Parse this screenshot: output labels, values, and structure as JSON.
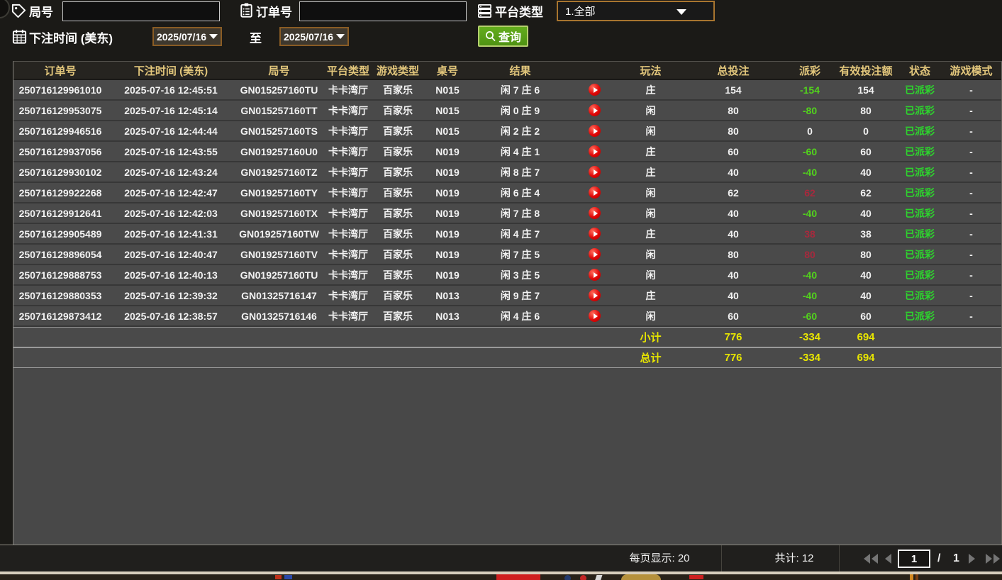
{
  "filters": {
    "round": {
      "label": "局号",
      "value": ""
    },
    "order": {
      "label": "订单号",
      "value": ""
    },
    "platform": {
      "label": "平台类型",
      "value": "1.全部"
    },
    "bet_time": {
      "label": "下注时间 (美东)"
    },
    "date_from": "2025/07/16",
    "to_label": "至",
    "date_to": "2025/07/16",
    "query_label": "查询"
  },
  "table": {
    "headers": [
      "订单号",
      "下注时间 (美东)",
      "局号",
      "平台类型",
      "游戏类型",
      "桌号",
      "结果",
      "",
      "玩法",
      "总投注",
      "派彩",
      "有效投注额",
      "状态",
      "游戏模式"
    ],
    "rows": [
      {
        "order_no": "250716129961010",
        "bet_time": "2025-07-16 12:45:51",
        "round_no": "GN015257160TU",
        "platform": "卡卡湾厅",
        "game_type": "百家乐",
        "table_no": "N015",
        "result": "闲 7 庄 6",
        "play_type": "庄",
        "total_bet": "154",
        "payout": "-154",
        "valid_bet": "154",
        "status": "已派彩",
        "game_mode": "-"
      },
      {
        "order_no": "250716129953075",
        "bet_time": "2025-07-16 12:45:14",
        "round_no": "GN015257160TT",
        "platform": "卡卡湾厅",
        "game_type": "百家乐",
        "table_no": "N015",
        "result": "闲 0 庄 9",
        "play_type": "闲",
        "total_bet": "80",
        "payout": "-80",
        "valid_bet": "80",
        "status": "已派彩",
        "game_mode": "-"
      },
      {
        "order_no": "250716129946516",
        "bet_time": "2025-07-16 12:44:44",
        "round_no": "GN015257160TS",
        "platform": "卡卡湾厅",
        "game_type": "百家乐",
        "table_no": "N015",
        "result": "闲 2 庄 2",
        "play_type": "闲",
        "total_bet": "80",
        "payout": "0",
        "valid_bet": "0",
        "status": "已派彩",
        "game_mode": "-"
      },
      {
        "order_no": "250716129937056",
        "bet_time": "2025-07-16 12:43:55",
        "round_no": "GN019257160U0",
        "platform": "卡卡湾厅",
        "game_type": "百家乐",
        "table_no": "N019",
        "result": "闲 4 庄 1",
        "play_type": "庄",
        "total_bet": "60",
        "payout": "-60",
        "valid_bet": "60",
        "status": "已派彩",
        "game_mode": "-"
      },
      {
        "order_no": "250716129930102",
        "bet_time": "2025-07-16 12:43:24",
        "round_no": "GN019257160TZ",
        "platform": "卡卡湾厅",
        "game_type": "百家乐",
        "table_no": "N019",
        "result": "闲 8 庄 7",
        "play_type": "庄",
        "total_bet": "40",
        "payout": "-40",
        "valid_bet": "40",
        "status": "已派彩",
        "game_mode": "-"
      },
      {
        "order_no": "250716129922268",
        "bet_time": "2025-07-16 12:42:47",
        "round_no": "GN019257160TY",
        "platform": "卡卡湾厅",
        "game_type": "百家乐",
        "table_no": "N019",
        "result": "闲 6 庄 4",
        "play_type": "闲",
        "total_bet": "62",
        "payout": "62",
        "valid_bet": "62",
        "status": "已派彩",
        "game_mode": "-"
      },
      {
        "order_no": "250716129912641",
        "bet_time": "2025-07-16 12:42:03",
        "round_no": "GN019257160TX",
        "platform": "卡卡湾厅",
        "game_type": "百家乐",
        "table_no": "N019",
        "result": "闲 7 庄 8",
        "play_type": "闲",
        "total_bet": "40",
        "payout": "-40",
        "valid_bet": "40",
        "status": "已派彩",
        "game_mode": "-"
      },
      {
        "order_no": "250716129905489",
        "bet_time": "2025-07-16 12:41:31",
        "round_no": "GN019257160TW",
        "platform": "卡卡湾厅",
        "game_type": "百家乐",
        "table_no": "N019",
        "result": "闲 4 庄 7",
        "play_type": "庄",
        "total_bet": "40",
        "payout": "38",
        "valid_bet": "38",
        "status": "已派彩",
        "game_mode": "-"
      },
      {
        "order_no": "250716129896054",
        "bet_time": "2025-07-16 12:40:47",
        "round_no": "GN019257160TV",
        "platform": "卡卡湾厅",
        "game_type": "百家乐",
        "table_no": "N019",
        "result": "闲 7 庄 5",
        "play_type": "闲",
        "total_bet": "80",
        "payout": "80",
        "valid_bet": "80",
        "status": "已派彩",
        "game_mode": "-"
      },
      {
        "order_no": "250716129888753",
        "bet_time": "2025-07-16 12:40:13",
        "round_no": "GN019257160TU",
        "platform": "卡卡湾厅",
        "game_type": "百家乐",
        "table_no": "N019",
        "result": "闲 3 庄 5",
        "play_type": "闲",
        "total_bet": "40",
        "payout": "-40",
        "valid_bet": "40",
        "status": "已派彩",
        "game_mode": "-"
      },
      {
        "order_no": "250716129880353",
        "bet_time": "2025-07-16 12:39:32",
        "round_no": "GN01325716147",
        "platform": "卡卡湾厅",
        "game_type": "百家乐",
        "table_no": "N013",
        "result": "闲 9 庄 7",
        "play_type": "庄",
        "total_bet": "40",
        "payout": "-40",
        "valid_bet": "40",
        "status": "已派彩",
        "game_mode": "-"
      },
      {
        "order_no": "250716129873412",
        "bet_time": "2025-07-16 12:38:57",
        "round_no": "GN01325716146",
        "platform": "卡卡湾厅",
        "game_type": "百家乐",
        "table_no": "N013",
        "result": "闲 4 庄 6",
        "play_type": "闲",
        "total_bet": "60",
        "payout": "-60",
        "valid_bet": "60",
        "status": "已派彩",
        "game_mode": "-"
      }
    ],
    "subtotal": {
      "label": "小计",
      "total_bet": "776",
      "payout": "-334",
      "valid_bet": "694"
    },
    "total": {
      "label": "总计",
      "total_bet": "776",
      "payout": "-334",
      "valid_bet": "694"
    }
  },
  "pagination": {
    "page_size_label": "每页显示: 20",
    "total_count_label": "共计: 12",
    "page_value": "1",
    "separator": "/",
    "total_pages": "1"
  },
  "icons": {
    "round": "tag-icon",
    "order": "clipboard-icon",
    "platform": "list-icon",
    "bet_time": "calendar-icon",
    "query": "search-icon",
    "result": "play-icon"
  },
  "colors": {
    "header_gold": "#e3c77c",
    "win_red": "#a7293d",
    "loss_green": "#52d41c",
    "status_green": "#2ed32e",
    "totals_yellow": "#e8e600",
    "button_green": "#4f9313",
    "date_border": "#8a5c24",
    "select_border": "#a8752f"
  }
}
